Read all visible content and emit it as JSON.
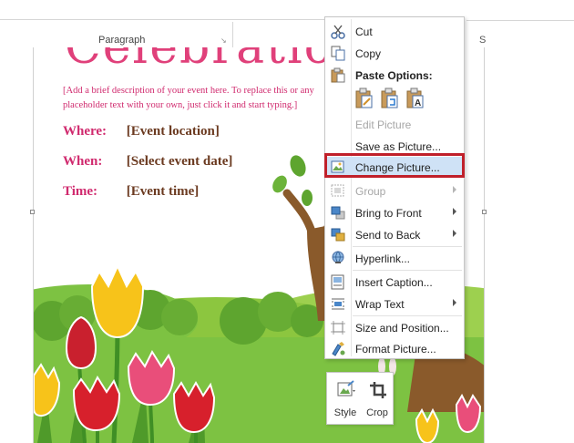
{
  "ribbon": {
    "group_label": "Paragraph",
    "right_fragment": "S"
  },
  "document": {
    "title": "Celebration",
    "description": "[Add a brief description of your event here. To replace this or any placeholder text with your own, just click it and start typing.]",
    "fields": [
      {
        "label": "Where:",
        "value": "[Event location]"
      },
      {
        "label": "When:",
        "value": "[Select event date]"
      },
      {
        "label": "Time:",
        "value": "[Event time]"
      }
    ]
  },
  "context_menu": {
    "items": {
      "cut": {
        "label": "Cut",
        "icon": "scissors-icon"
      },
      "copy": {
        "label": "Copy",
        "icon": "copy-icon"
      },
      "paste_options": {
        "label": "Paste Options:",
        "icon": "paste-icon"
      },
      "edit_picture": {
        "label": "Edit Picture",
        "disabled": true
      },
      "save_as_picture": {
        "label": "Save as Picture...",
        "icon": "none"
      },
      "change_picture": {
        "label": "Change Picture...",
        "icon": "change-picture-icon",
        "highlighted": true
      },
      "group": {
        "label": "Group",
        "icon": "group-icon",
        "disabled": true,
        "submenu": true
      },
      "bring_to_front": {
        "label": "Bring to Front",
        "icon": "bring-to-front-icon",
        "submenu": true
      },
      "send_to_back": {
        "label": "Send to Back",
        "icon": "send-to-back-icon",
        "submenu": true
      },
      "hyperlink": {
        "label": "Hyperlink...",
        "icon": "hyperlink-icon"
      },
      "insert_caption": {
        "label": "Insert Caption...",
        "icon": "insert-caption-icon"
      },
      "wrap_text": {
        "label": "Wrap Text",
        "icon": "wrap-text-icon",
        "submenu": true
      },
      "size_position": {
        "label": "Size and Position...",
        "icon": "size-position-icon"
      },
      "format_picture": {
        "label": "Format Picture...",
        "icon": "format-picture-icon"
      }
    },
    "paste_buttons": [
      "paste-keep-format-icon",
      "paste-merge-icon",
      "paste-text-only-icon"
    ]
  },
  "mini_toolbar": {
    "style_label": "Style",
    "crop_label": "Crop"
  },
  "colors": {
    "accent_pink": "#d02a6e",
    "title_pink": "#e0407a",
    "value_brown": "#6b3a20",
    "highlight_red": "#c0202a",
    "grass_green": "#7dc242"
  }
}
